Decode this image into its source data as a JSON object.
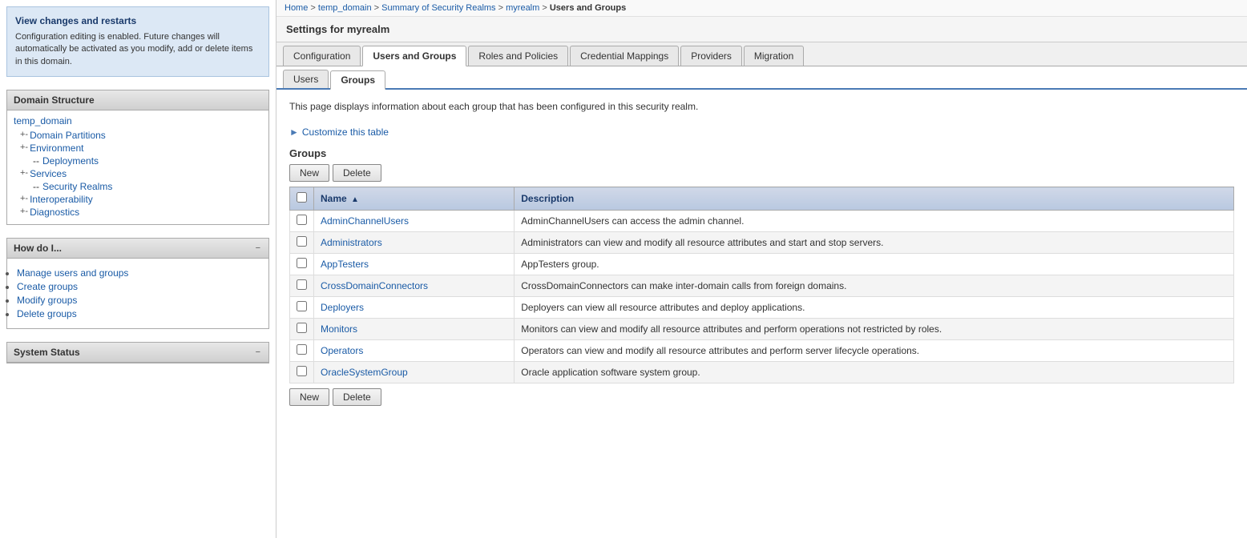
{
  "breadcrumb": {
    "items": [
      "Home",
      "temp_domain",
      "Summary of Security Realms",
      "myrealm"
    ],
    "current": "Users and Groups",
    "separator": " >"
  },
  "settings_header": "Settings for myrealm",
  "tabs": [
    {
      "label": "Configuration",
      "active": false
    },
    {
      "label": "Users and Groups",
      "active": true
    },
    {
      "label": "Roles and Policies",
      "active": false
    },
    {
      "label": "Credential Mappings",
      "active": false
    },
    {
      "label": "Providers",
      "active": false
    },
    {
      "label": "Migration",
      "active": false
    }
  ],
  "sub_tabs": [
    {
      "label": "Users",
      "active": false
    },
    {
      "label": "Groups",
      "active": true
    }
  ],
  "description": "This page displays information about each group that has been configured in this security realm.",
  "customize_label": "Customize this table",
  "groups_title": "Groups",
  "buttons": {
    "new_label": "New",
    "delete_label": "Delete"
  },
  "table": {
    "columns": [
      {
        "label": "Name",
        "sort": true
      },
      {
        "label": "Description"
      }
    ],
    "rows": [
      {
        "name": "AdminChannelUsers",
        "description": "AdminChannelUsers can access the admin channel."
      },
      {
        "name": "Administrators",
        "description": "Administrators can view and modify all resource attributes and start and stop servers."
      },
      {
        "name": "AppTesters",
        "description": "AppTesters group."
      },
      {
        "name": "CrossDomainConnectors",
        "description": "CrossDomainConnectors can make inter-domain calls from foreign domains."
      },
      {
        "name": "Deployers",
        "description": "Deployers can view all resource attributes and deploy applications."
      },
      {
        "name": "Monitors",
        "description": "Monitors can view and modify all resource attributes and perform operations not restricted by roles."
      },
      {
        "name": "Operators",
        "description": "Operators can view and modify all resource attributes and perform server lifecycle operations."
      },
      {
        "name": "OracleSystemGroup",
        "description": "Oracle application software system group."
      }
    ]
  },
  "sidebar": {
    "view_changes": {
      "title": "View changes and restarts",
      "text": "Configuration editing is enabled. Future changes will automatically be activated as you modify, add or delete items in this domain."
    },
    "domain_structure": {
      "title": "Domain Structure",
      "root": "temp_domain",
      "items": [
        {
          "label": "Domain Partitions",
          "expandable": true
        },
        {
          "label": "Environment",
          "expandable": true
        },
        {
          "label": "Deployments",
          "expandable": false
        },
        {
          "label": "Services",
          "expandable": true
        },
        {
          "label": "Security Realms",
          "expandable": false
        },
        {
          "label": "Interoperability",
          "expandable": true
        },
        {
          "label": "Diagnostics",
          "expandable": true
        }
      ]
    },
    "how_do_i": {
      "title": "How do I...",
      "items": [
        "Manage users and groups",
        "Create groups",
        "Modify groups",
        "Delete groups"
      ]
    },
    "system_status": {
      "title": "System Status"
    }
  }
}
